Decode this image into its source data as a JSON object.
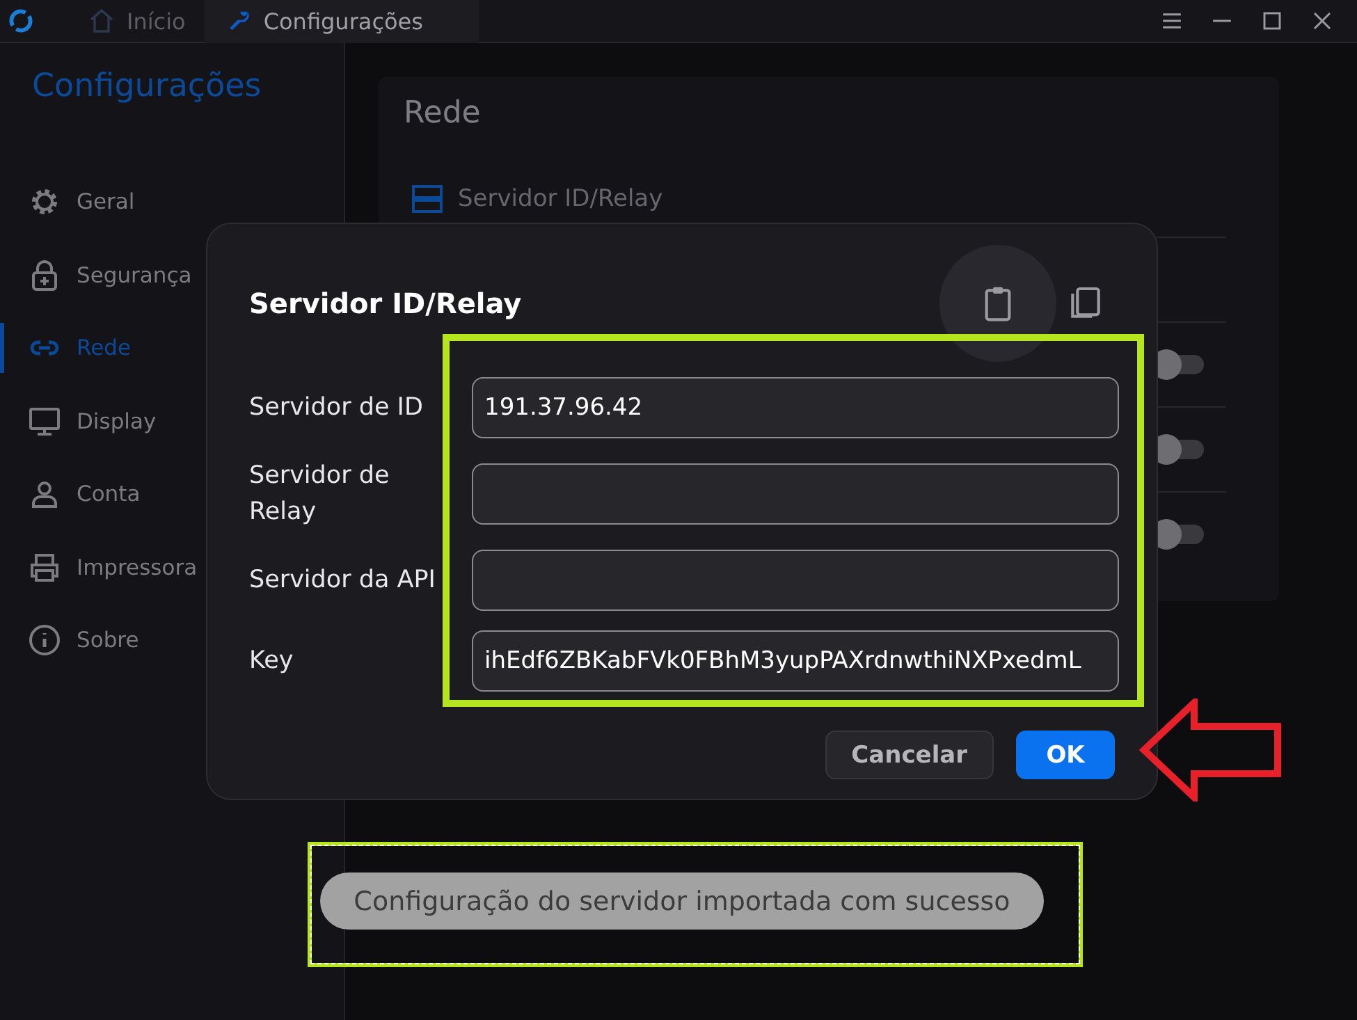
{
  "window": {
    "tabs": [
      {
        "label": "Início",
        "selected": false,
        "kind": "home"
      },
      {
        "label": "Configurações",
        "selected": true,
        "kind": "wrench"
      }
    ]
  },
  "sidebar": {
    "title": "Configurações",
    "items": [
      {
        "label": "Geral",
        "kind": "gear",
        "selected": false
      },
      {
        "label": "Segurança",
        "kind": "lock",
        "selected": false
      },
      {
        "label": "Rede",
        "kind": "link",
        "selected": true
      },
      {
        "label": "Display",
        "kind": "monitor",
        "selected": false
      },
      {
        "label": "Conta",
        "kind": "person",
        "selected": false
      },
      {
        "label": "Impressora",
        "kind": "printer",
        "selected": false
      },
      {
        "label": "Sobre",
        "kind": "info",
        "selected": false
      }
    ]
  },
  "card": {
    "title": "Rede",
    "item": "Servidor ID/Relay",
    "toggles": [
      {
        "on": false
      },
      {
        "on": false
      },
      {
        "on": false
      }
    ]
  },
  "dialog": {
    "title": "Servidor ID/Relay",
    "fields": [
      {
        "label": "Servidor de ID",
        "value": "191.37.96.42"
      },
      {
        "label": "Servidor de Relay"
      },
      {
        "label": "Servidor da API"
      },
      {
        "label": "Key",
        "value": "ihEdf6ZBKabFVk0FBhM3yupPAXrdnwthiNXPxedmL"
      }
    ],
    "buttons": [
      {
        "label": "Cancelar",
        "kind": "secondary"
      },
      {
        "label": "OK",
        "kind": "primary"
      }
    ]
  },
  "toast": "Configuração do servidor importada com sucesso"
}
